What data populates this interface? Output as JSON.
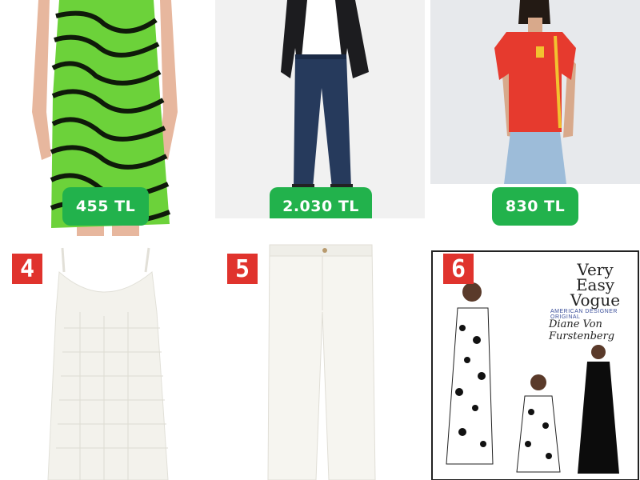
{
  "products": [
    {
      "price": "455 TL",
      "description": "green zebra print slip dress",
      "icon": "zebra-dress-image"
    },
    {
      "price": "2.030 TL",
      "description": "man in black jacket and dark jeans",
      "icon": "jeans-outfit-image"
    },
    {
      "price": "830 TL",
      "description": "red Spain football jersey",
      "icon": "spain-jersey-image"
    },
    {
      "badge": "4",
      "description": "white crochet knit dress",
      "icon": "knit-dress-image"
    },
    {
      "badge": "5",
      "description": "white straight jeans",
      "icon": "white-jeans-image"
    },
    {
      "badge": "6",
      "description": "Very Easy Vogue sewing pattern envelope",
      "icon": "vogue-pattern-image",
      "pattern": {
        "title_line1": "Very",
        "title_line2": "Easy",
        "title_line3": "Vogue",
        "subtitle": "AMERICAN DESIGNER ORIGINAL",
        "designer": "Diane Von Furstenberg"
      }
    }
  ],
  "colors": {
    "price_badge": "#22b24c",
    "number_badge": "#e0332d"
  }
}
